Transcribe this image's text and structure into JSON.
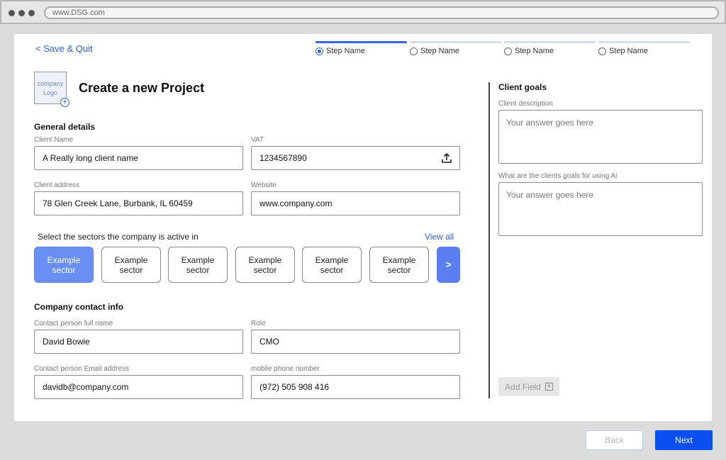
{
  "browser": {
    "url": "www.DSG.com"
  },
  "nav": {
    "save_quit": "< Save & Quit"
  },
  "steps": [
    {
      "label": "Step Name",
      "active": true
    },
    {
      "label": "Step Name",
      "active": false
    },
    {
      "label": "Step Name",
      "active": false
    },
    {
      "label": "Step Name",
      "active": false
    }
  ],
  "logo": {
    "text": "company Logo",
    "add_icon": "plus-circle-icon"
  },
  "page_title": "Create a new Project",
  "general": {
    "heading": "General details",
    "client_name_label": "Client Name",
    "client_name_value": "A Really long client name",
    "vat_label": "VAT",
    "vat_value": "1234567890",
    "vat_icon": "upload-icon",
    "address_label": "Client address",
    "address_value": "78 Glen Creek Lane, Burbank, IL 60459",
    "website_label": "Website",
    "website_value": "www.company.com"
  },
  "sectors": {
    "label": "Select the sectors the company is active in",
    "view_all": "View all",
    "items": [
      {
        "label": "Example sector",
        "selected": true
      },
      {
        "label": "Example sector",
        "selected": false
      },
      {
        "label": "Example sector",
        "selected": false
      },
      {
        "label": "Example sector",
        "selected": false
      },
      {
        "label": "Example sector",
        "selected": false
      },
      {
        "label": "Example sector",
        "selected": false
      }
    ],
    "next_label": ">"
  },
  "contact": {
    "heading": "Company contact info",
    "name_label": "Contact person full name",
    "name_value": "David Bowie",
    "role_label": "Role",
    "role_value": "CMO",
    "email_label": "Contact person Email address",
    "email_value": "davidb@company.com",
    "phone_label": "mobile phone number",
    "phone_value": "(972) 505 908 416"
  },
  "goals": {
    "heading": "Client goals",
    "description_label": "Client description",
    "description_placeholder": "Your answer goes here",
    "ai_label": "What are the clients goals for using Ai",
    "ai_placeholder": "Your answer goes here",
    "add_field": "Add Field"
  },
  "footer": {
    "back": "Back",
    "next": "Next"
  },
  "colors": {
    "accent": "#0b4ff0",
    "selected_sector": "#6a8ff2",
    "link": "#2d5ee0"
  }
}
